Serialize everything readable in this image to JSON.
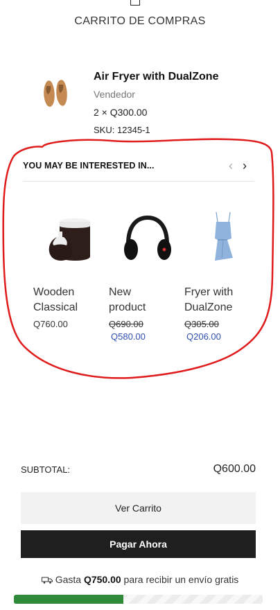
{
  "header": {
    "title": "CARRITO DE COMPRAS"
  },
  "cart_item": {
    "title": "Air Fryer with DualZone",
    "vendor": "Vendedor",
    "qty_price": "2 × Q300.00",
    "sku": "SKU: 12345-1",
    "image_icon": "loafer-shoes-icon"
  },
  "recommendations": {
    "heading": "YOU MAY BE INTERESTED IN...",
    "products": [
      {
        "name_line1": "Wooden",
        "name_line2": "Classical",
        "price": "Q760.00",
        "image_icon": "vase-icon"
      },
      {
        "name_line1": "New",
        "name_line2": "product",
        "price_old": "Q690.00",
        "price_new": "Q580.00",
        "image_icon": "headphones-icon"
      },
      {
        "name_line1": "Fryer with",
        "name_line2": "DualZone",
        "price_old": "Q305.00",
        "price_new": "Q206.00",
        "image_icon": "dress-icon"
      }
    ]
  },
  "summary": {
    "subtotal_label": "SUBTOTAL:",
    "subtotal_value": "Q600.00",
    "view_cart_label": "Ver Carrito",
    "checkout_label": "Pagar Ahora"
  },
  "shipping": {
    "prefix": "Gasta",
    "amount": "Q750.00",
    "suffix": "para recibir un envío gratis",
    "progress_fraction": 0.44
  },
  "colors": {
    "progress": "#2f8a3a",
    "sale_price": "#2f4fb5",
    "annotation": "#e01b1b"
  }
}
